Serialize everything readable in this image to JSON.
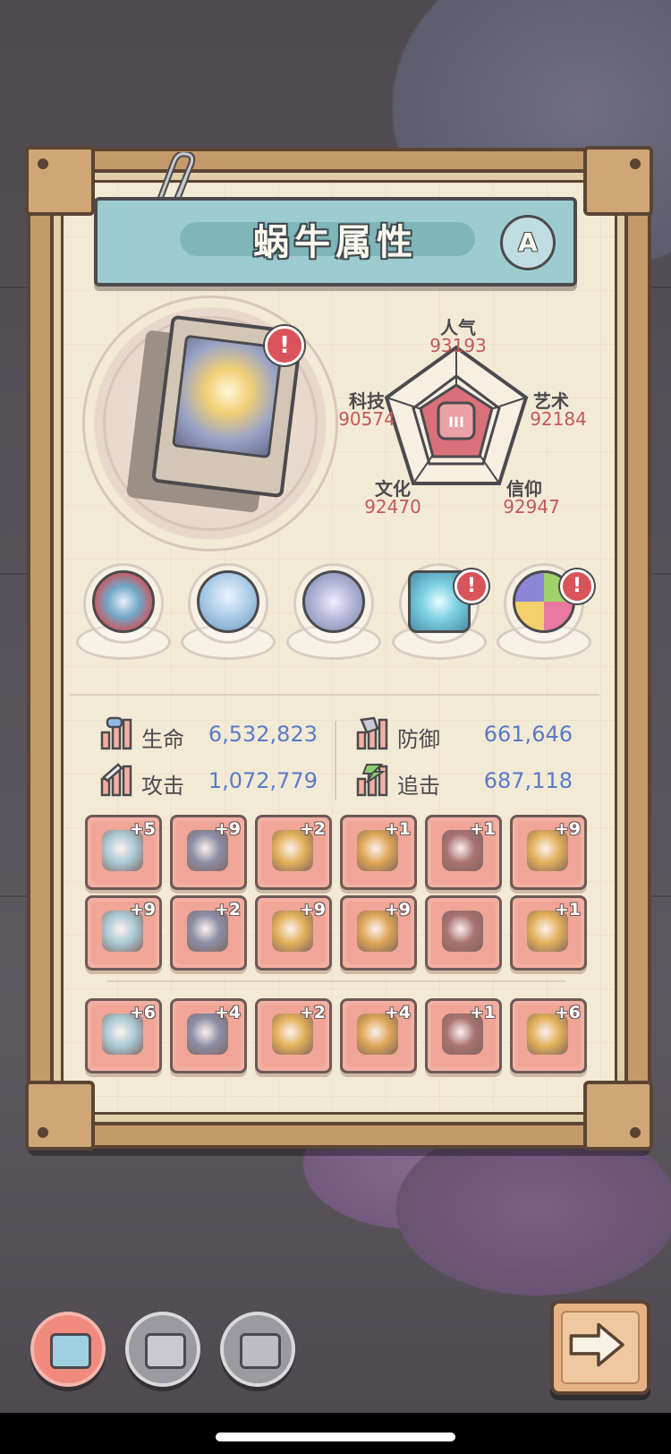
{
  "panel": {
    "title": "蜗牛属性",
    "rank_badge": "A"
  },
  "emblem": {
    "alert_mark": "!"
  },
  "radar": {
    "stats": [
      {
        "label": "人气",
        "value": "93193"
      },
      {
        "label": "艺术",
        "value": "92184"
      },
      {
        "label": "信仰",
        "value": "92947"
      },
      {
        "label": "文化",
        "value": "92470"
      },
      {
        "label": "科技",
        "value": "90574"
      }
    ],
    "center_glyph": "III"
  },
  "orbs": [
    {
      "name": "spiked-creature",
      "alert": false
    },
    {
      "name": "tornado",
      "alert": false
    },
    {
      "name": "compass",
      "alert": false
    },
    {
      "name": "eye-tablet",
      "alert": true
    },
    {
      "name": "gem-ring",
      "alert": true
    }
  ],
  "attributes": {
    "hp": {
      "label": "生命",
      "value": "6,532,823"
    },
    "defense": {
      "label": "防御",
      "value": "661,646"
    },
    "attack": {
      "label": "攻击",
      "value": "1,072,779"
    },
    "pursuit": {
      "label": "追击",
      "value": "687,118"
    }
  },
  "equipment": {
    "row1": [
      "+5",
      "+9",
      "+2",
      "+1",
      "+1",
      "+9"
    ],
    "row2": [
      "+9",
      "+2",
      "+9",
      "+9",
      "",
      "+1"
    ],
    "row3": [
      "+6",
      "+4",
      "+2",
      "+4",
      "+1",
      "+6"
    ]
  },
  "colors": {
    "accent_value": "#c4585b",
    "stat_number": "#5a7bc9",
    "title_banner": "#9dccd0",
    "slot": "#f2b0a2"
  }
}
